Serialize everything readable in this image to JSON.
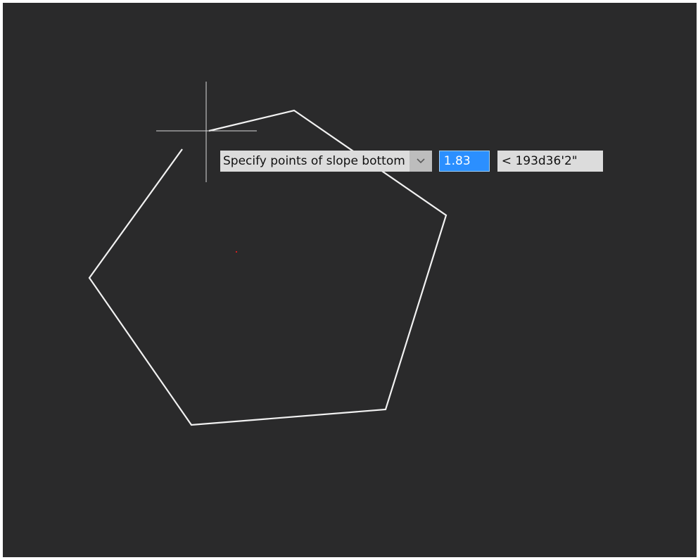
{
  "canvas": {
    "background": "#2a2a2b",
    "line_color": "#f2f2f2",
    "crosshair_color": "#d8d8d8",
    "center_mark_color": "#d02020"
  },
  "dynamic_input": {
    "prompt": "Specify points of slope bottom",
    "dropdown_icon": "chevron-down-icon",
    "length_value": "1.83",
    "angle_value": "< 193d36'2\""
  }
}
